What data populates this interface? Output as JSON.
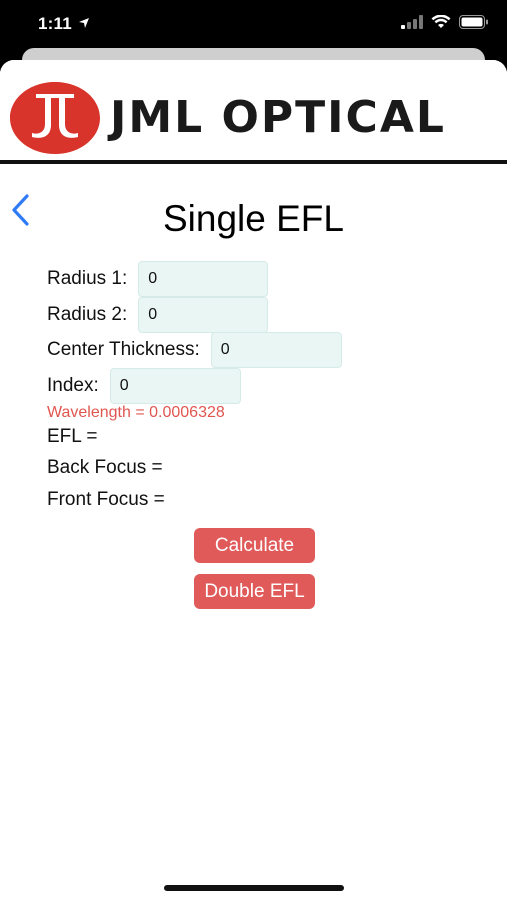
{
  "status": {
    "time": "1:11",
    "icons": [
      "location-arrow-icon",
      "cellular-signal-icon",
      "wifi-icon",
      "battery-icon"
    ]
  },
  "header": {
    "brand": "JML OPTICAL",
    "logo": "jml-logo-mark",
    "brand_color": "#d9342b"
  },
  "page": {
    "title": "Single EFL",
    "back_icon": "chevron-left-icon"
  },
  "form": {
    "radius1": {
      "label": "Radius 1:",
      "value": "0"
    },
    "radius2": {
      "label": "Radius 2:",
      "value": "0"
    },
    "thickness": {
      "label": "Center Thickness:",
      "value": "0"
    },
    "index": {
      "label": "Index:",
      "value": "0"
    },
    "wavelength": "Wavelength = 0.0006328"
  },
  "results": {
    "efl": "EFL =",
    "back_focus": "Back Focus =",
    "front_focus": "Front Focus ="
  },
  "buttons": {
    "calculate": "Calculate",
    "double_efl": "Double EFL"
  },
  "colors": {
    "accent": "#e05a5a",
    "wavelength_text": "#e0564f",
    "input_bg": "#eaf6f4",
    "back_chevron": "#2f7bf5"
  }
}
